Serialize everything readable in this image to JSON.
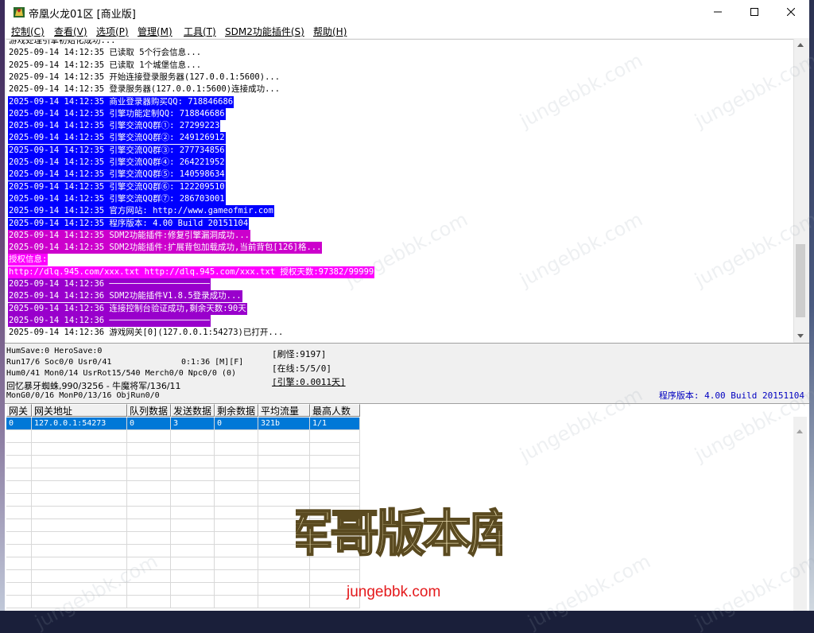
{
  "window": {
    "title": "帝凰火龙01区 [商业版]",
    "accent": "#0000ff"
  },
  "menu": [
    {
      "label": "控制(C)"
    },
    {
      "label": "查看(V)"
    },
    {
      "label": "选项(P)"
    },
    {
      "label": "管理(M)"
    },
    {
      "label": "工具(T)"
    },
    {
      "label": "SDM2功能插件(S)"
    },
    {
      "label": "帮助(H)"
    }
  ],
  "log": {
    "lines": [
      {
        "text": "游戏处理引擎初始化成功...",
        "bg": "#ffffff",
        "fg": "#000000"
      },
      {
        "text": "2025-09-14 14:12:35 已读取 5个行会信息...",
        "bg": "#ffffff",
        "fg": "#000000"
      },
      {
        "text": "2025-09-14 14:12:35 已读取 1个城堡信息...",
        "bg": "#ffffff",
        "fg": "#000000"
      },
      {
        "text": "2025-09-14 14:12:35 开始连接登录服务器(127.0.0.1:5600)...",
        "bg": "#ffffff",
        "fg": "#000000"
      },
      {
        "text": "2025-09-14 14:12:35 登录服务器(127.0.0.1:5600)连接成功...",
        "bg": "#ffffff",
        "fg": "#000000"
      },
      {
        "text": "2025-09-14 14:12:35 商业登录器购买QQ: 718846686",
        "bg": "#0000ff",
        "fg": "#ffffff"
      },
      {
        "text": "2025-09-14 14:12:35 引擎功能定制QQ: 718846686",
        "bg": "#0000ff",
        "fg": "#ffffff"
      },
      {
        "text": "2025-09-14 14:12:35 引擎交流QQ群①: 27299223",
        "bg": "#0000ff",
        "fg": "#ffffff"
      },
      {
        "text": "2025-09-14 14:12:35 引擎交流QQ群②: 249126912",
        "bg": "#0000ff",
        "fg": "#ffffff"
      },
      {
        "text": "2025-09-14 14:12:35 引擎交流QQ群③: 277734856",
        "bg": "#0000ff",
        "fg": "#ffffff"
      },
      {
        "text": "2025-09-14 14:12:35 引擎交流QQ群④: 264221952",
        "bg": "#0000ff",
        "fg": "#ffffff"
      },
      {
        "text": "2025-09-14 14:12:35 引擎交流QQ群⑤: 140598634",
        "bg": "#0000ff",
        "fg": "#ffffff"
      },
      {
        "text": "2025-09-14 14:12:35 引擎交流QQ群⑥: 122209510",
        "bg": "#0000ff",
        "fg": "#ffffff"
      },
      {
        "text": "2025-09-14 14:12:35 引擎交流QQ群⑦: 286703001",
        "bg": "#0000ff",
        "fg": "#ffffff"
      },
      {
        "text": "2025-09-14 14:12:35 官方网站: http://www.gameofmir.com",
        "bg": "#0000ff",
        "fg": "#ffffff"
      },
      {
        "text": "2025-09-14 14:12:35 程序版本: 4.00 Build 20151104",
        "bg": "#0000ff",
        "fg": "#ffffff"
      },
      {
        "text": "2025-09-14 14:12:35 SDM2功能插件:修复引擎漏洞成功...",
        "bg": "#cc00cc",
        "fg": "#ffffff"
      },
      {
        "text": "2025-09-14 14:12:35 SDM2功能插件:扩展背包加载成功,当前背包[126]格...",
        "bg": "#cc00cc",
        "fg": "#ffffff"
      },
      {
        "text": "授权信息:",
        "bg": "#ff00ff",
        "fg": "#ffffff"
      },
      {
        "text": "http://dlq.945.com/xxx.txt http://dlq.945.com/xxx.txt 授权天数:97382/99999",
        "bg": "#ff00ff",
        "fg": "#ffffff"
      },
      {
        "text": "2025-09-14 14:12:36 ────────────────────",
        "bg": "#9900cc",
        "fg": "#ffffff"
      },
      {
        "text": "2025-09-14 14:12:36 SDM2功能插件V1.8.5登录成功...",
        "bg": "#9900cc",
        "fg": "#ffffff"
      },
      {
        "text": "2025-09-14 14:12:36 连接控制台验证成功,剩余天数:90天",
        "bg": "#9900cc",
        "fg": "#ffffff"
      },
      {
        "text": "2025-09-14 14:12:36 ────────────────────",
        "bg": "#9900cc",
        "fg": "#ffffff"
      },
      {
        "text": "2025-09-14 14:12:36 游戏网关[0](127.0.0.1:54273)已打开...",
        "bg": "#ffffff",
        "fg": "#000000"
      }
    ]
  },
  "status": {
    "line1": "HumSave:0 HeroSave:0",
    "line2a": "Run17/6 Soc0/0 Usr0/41",
    "line2b": "0:1:36 [M][F]",
    "line3": "Hum0/41 Mon0/14 UsrRot15/540 Merch0/0 Npc0/0 (0)",
    "line4": "回忆暴牙蜘蛛,990/3256 - 牛魔将军/136/11",
    "line5": "MonG0/0/16 MonP0/13/16 ObjRun0/0",
    "box1": "[刷怪:9197]",
    "box2": "[在线:5/5/0]",
    "box3": "[引擎:0.0011天]",
    "version": "程序版本: 4.00 Build 20151104"
  },
  "grid": {
    "headers": [
      "网关",
      "网关地址",
      "队列数据",
      "发送数据",
      "剩余数据",
      "平均流量",
      "最高人数"
    ],
    "rows": [
      [
        "0",
        "127.0.0.1:54273",
        "0",
        "3",
        "0",
        "321b",
        "1/1"
      ]
    ],
    "empty_rows": 14,
    "selected_color": "#0078d7"
  },
  "watermark": {
    "site": "jungebbk.com",
    "logo_text": "军哥版本库",
    "url_text": "jungebbk.com",
    "url_color": "#e41a1c"
  }
}
